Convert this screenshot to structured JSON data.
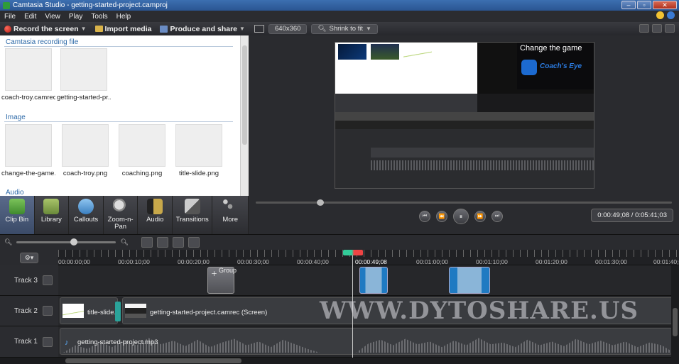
{
  "window": {
    "title": "Camtasia Studio - getting-started-project.camproj"
  },
  "menu": [
    "File",
    "Edit",
    "View",
    "Play",
    "Tools",
    "Help"
  ],
  "toolbar": {
    "record": "Record the screen",
    "import": "Import media",
    "produce": "Produce and share"
  },
  "preview_toolbar": {
    "dimensions": "640x360",
    "zoom": "Shrink to fit"
  },
  "clip_bin": {
    "sections": {
      "recording": "Camtasia recording file",
      "image": "Image",
      "audio": "Audio"
    },
    "recording_clips": [
      "coach-troy.camrec",
      "getting-started-pr..."
    ],
    "image_clips": [
      "change-the-game....",
      "coach-troy.png",
      "coaching.png",
      "title-slide.png"
    ]
  },
  "tabs": [
    "Clip Bin",
    "Library",
    "Callouts",
    "Zoom-n-Pan",
    "Audio",
    "Transitions",
    "More"
  ],
  "preview": {
    "canvas_text": "Change the game",
    "canvas_logo": "Coach's Eye",
    "time_current": "0:00:49;08",
    "time_total": "0:05:41;03",
    "timecode": "0:00:49;08 / 0:05:41;03"
  },
  "timeline": {
    "ruler": [
      "00:00:00;00",
      "00:00:10;00",
      "00:00:20;00",
      "00:00:30;00",
      "00:00:40;00",
      "00:00:49;08",
      "00:01:00;00",
      "00:01:10;00",
      "00:01:20;00",
      "00:01:30;00",
      "00:01:40;00"
    ],
    "tracks": [
      "Track 3",
      "Track 2",
      "Track 1"
    ],
    "group_label": "Group",
    "track2_clips": [
      "title-slide.p",
      "getting-started-project.camrec (Screen)"
    ],
    "track1_clip": "getting-started-project.mp3"
  },
  "watermark": "WWW.DYTOSHARE.US"
}
